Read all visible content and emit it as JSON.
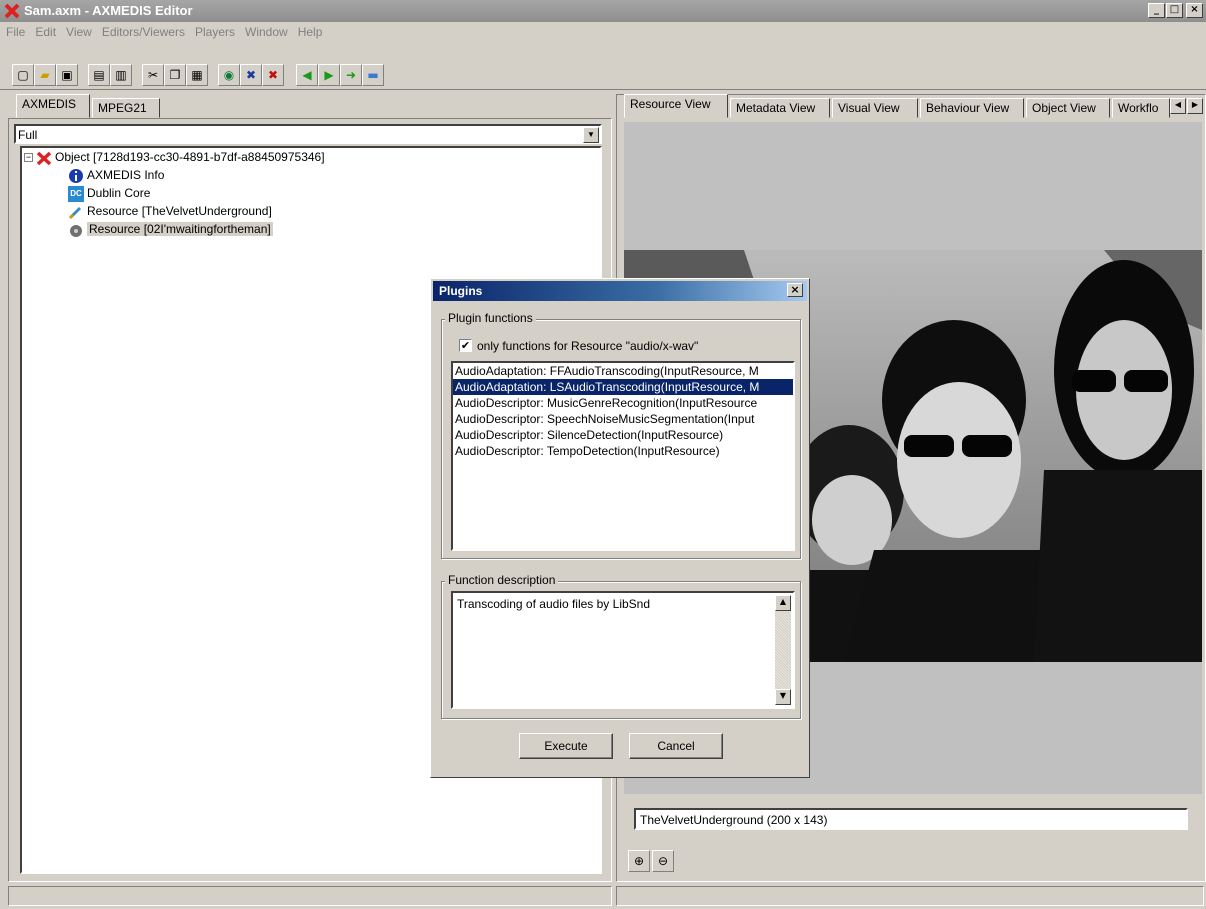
{
  "window": {
    "title": "Sam.axm - AXMEDIS Editor",
    "minimize": "_",
    "maximize": "□",
    "close": "×"
  },
  "menu": [
    "File",
    "Edit",
    "View",
    "Editors/Viewers",
    "Players",
    "Window",
    "Help"
  ],
  "left_panel": {
    "tabs": [
      "AXMEDIS",
      "MPEG21"
    ],
    "view_mode": "Full",
    "tree": [
      {
        "label": "Object [7128d193-cc30-4891-b7df-a88450975346]",
        "icon": "axmedis-object-icon"
      },
      {
        "label": "AXMEDIS Info",
        "icon": "info-icon"
      },
      {
        "label": "Dublin Core",
        "icon": "dublin-core-icon",
        "icon_text": "DC"
      },
      {
        "label": "Resource [TheVelvetUnderground]",
        "icon": "image-resource-icon"
      },
      {
        "label": "Resource [02I'mwaitingfortheman]",
        "icon": "audio-resource-icon"
      }
    ]
  },
  "right_panel": {
    "tabs": [
      "Resource View",
      "Metadata View",
      "Visual View",
      "Behaviour View",
      "Object View",
      "Workflo"
    ],
    "caption": "TheVelvetUnderground  (200 x 143)"
  },
  "dialog": {
    "title": "Plugins",
    "group_functions": "Plugin functions",
    "filter_label": "only functions for Resource \"audio/x-wav\"",
    "filter_checked": true,
    "functions": [
      "AudioAdaptation: FFAudioTranscoding(InputResource, M",
      "AudioAdaptation: LSAudioTranscoding(InputResource, M",
      "AudioDescriptor: MusicGenreRecognition(InputResource",
      "AudioDescriptor: SpeechNoiseMusicSegmentation(Input",
      "AudioDescriptor: SilenceDetection(InputResource)",
      "AudioDescriptor: TempoDetection(InputResource)"
    ],
    "selected_index": 1,
    "group_description": "Function description",
    "description": "Transcoding of audio files by LibSnd",
    "execute_label": "Execute",
    "cancel_label": "Cancel"
  },
  "colors": {
    "selection": "#0a246a",
    "dialog_title": "#0a246a",
    "workspace": "#c0c0c0"
  }
}
